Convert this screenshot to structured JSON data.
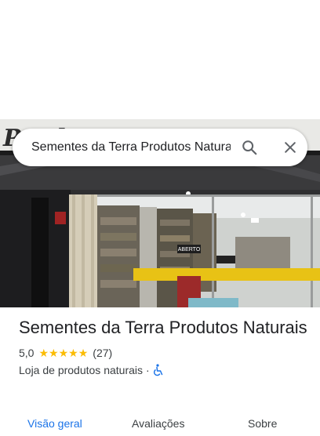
{
  "search": {
    "query": "Sementes da Terra Produtos Natura"
  },
  "place": {
    "name": "Sementes da Terra Produtos Naturais",
    "rating": "5,0",
    "stars": 5,
    "review_count": "(27)",
    "category": "Loja de produtos naturais",
    "separator": "·",
    "accessibility_icon": "wheelchair-icon"
  },
  "photo": {
    "sign_text": "Produtos",
    "door_sign": "ABERTO"
  },
  "tabs": [
    {
      "label": "Visão geral",
      "active": true
    },
    {
      "label": "Avaliações",
      "active": false
    },
    {
      "label": "Sobre",
      "active": false
    }
  ],
  "colors": {
    "accent": "#1a73e8",
    "star": "#fbbc04",
    "accessibility": "#1a73e8"
  }
}
